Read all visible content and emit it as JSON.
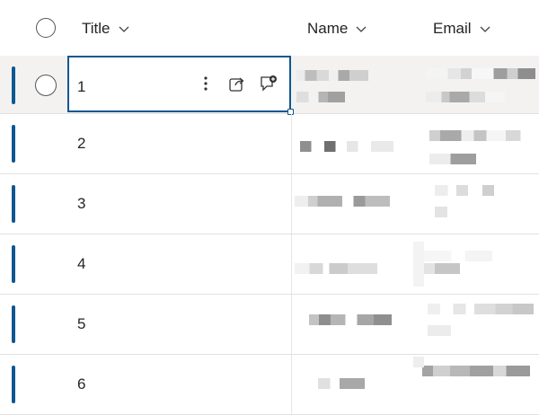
{
  "header": {
    "title_label": "Title",
    "name_label": "Name",
    "email_label": "Email"
  },
  "rows": [
    {
      "title": "1"
    },
    {
      "title": "2"
    },
    {
      "title": "3"
    },
    {
      "title": "4"
    },
    {
      "title": "5"
    },
    {
      "title": "6"
    }
  ],
  "colors": {
    "accent": "#0f5791",
    "selected_row_bg": "#f3f2f1",
    "divider": "#e1e1e1"
  },
  "icons": {
    "more": "more-options-icon",
    "share": "share-icon",
    "comment": "comment-icon",
    "chevron": "chevron-down-icon"
  }
}
